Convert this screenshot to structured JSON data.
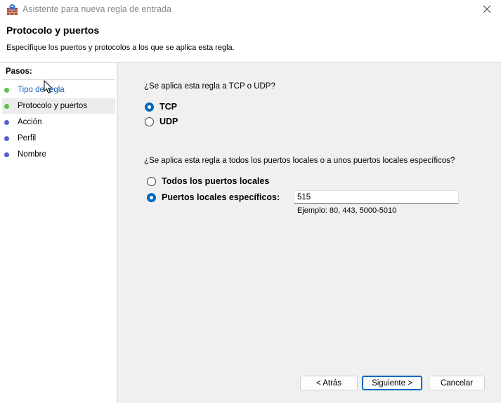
{
  "window": {
    "title": "Asistente para nueva regla de entrada",
    "close_glyph": "✕"
  },
  "header": {
    "title": "Protocolo y puertos",
    "subtitle": "Especifique los puertos y protocolos a los que se aplica esta regla."
  },
  "steps": {
    "label": "Pasos:",
    "items": [
      {
        "label": "Tipo de regla",
        "state": "done",
        "dot_color": "#5cc14a"
      },
      {
        "label": "Protocolo y puertos",
        "state": "current",
        "dot_color": "#5cc14a"
      },
      {
        "label": "Acción",
        "state": "pending",
        "dot_color": "#5b5fc9"
      },
      {
        "label": "Perfil",
        "state": "pending",
        "dot_color": "#5b5fc9"
      },
      {
        "label": "Nombre",
        "state": "pending",
        "dot_color": "#5b5fc9"
      }
    ]
  },
  "protocol": {
    "question": "¿Se aplica esta regla a TCP o UDP?",
    "options": [
      {
        "label": "TCP",
        "checked": true
      },
      {
        "label": "UDP",
        "checked": false
      }
    ]
  },
  "ports": {
    "question": "¿Se aplica esta regla a todos los puertos locales o a unos puertos locales específicos?",
    "options": [
      {
        "label": "Todos los puertos locales",
        "checked": false
      },
      {
        "label": "Puertos locales específicos:",
        "checked": true
      }
    ],
    "input_value": "515",
    "example": "Ejemplo: 80, 443, 5000-5010"
  },
  "buttons": {
    "back": "< Atrás",
    "next": "Siguiente >",
    "cancel": "Cancelar"
  },
  "colors": {
    "accent": "#0067c0",
    "done_dot": "#5cc14a",
    "pending_dot": "#5b5fc9",
    "link": "#1a5fb4"
  },
  "icons": {
    "app": "firewall-wall-icon",
    "close": "close-icon",
    "cursor": "mouse-pointer-icon"
  }
}
